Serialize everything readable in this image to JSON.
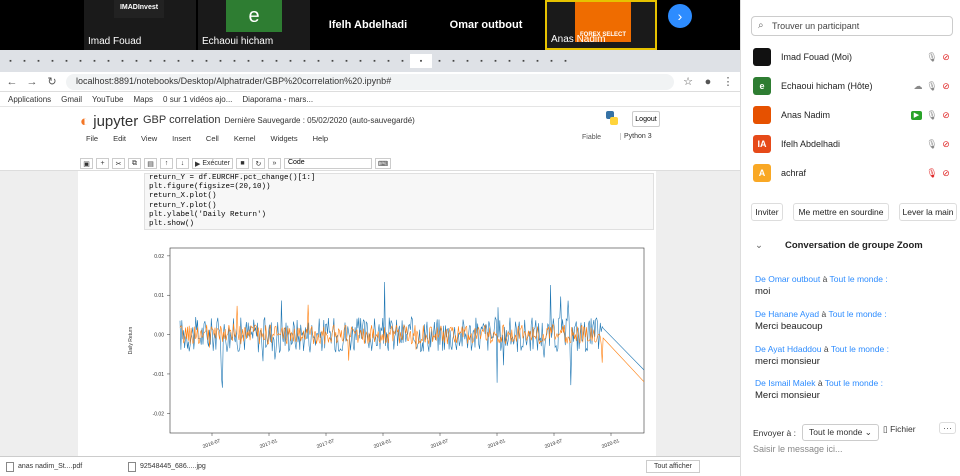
{
  "zoom_strip": {
    "tiles": [
      {
        "name": "Imad Fouad",
        "logo_text": "IMADInvest"
      },
      {
        "name": "Echaoui hicham",
        "avatar": "e"
      },
      {
        "name": "Ifelh Abdelhadi"
      },
      {
        "name": "Omar outbout"
      },
      {
        "name": "Anas Nadim",
        "logo_text": "FOREX SELECT"
      }
    ]
  },
  "browser": {
    "url": "localhost:8891/notebooks/Desktop/Alphatrader/GBP%20correlation%20.ipynb#",
    "bookmarks": [
      "Applications",
      "Gmail",
      "YouTube",
      "Maps",
      "0 sur 1 vidéos ajo...",
      "Diaporama - mars..."
    ]
  },
  "jupyter": {
    "logo": "jupyter",
    "notebook_title": "GBP correlation",
    "save_status": "Dernière Sauvegarde : 05/02/2020  (auto-sauvegardé)",
    "logout_label": "Logout",
    "menu": [
      "File",
      "Edit",
      "View",
      "Insert",
      "Cell",
      "Kernel",
      "Widgets",
      "Help"
    ],
    "trusted": "Fiable",
    "kernel": "Python 3",
    "run_label": "Exécuter",
    "cell_type": "Code",
    "code_lines": [
      "return_Y = df.EURCHF.pct_change()[1:]",
      "plt.figure(figsize=(20,10))",
      "return_X.plot()",
      "return_Y.plot()",
      "plt.ylabel('Daily Return')",
      "plt.show()"
    ]
  },
  "chart_data": {
    "type": "line",
    "ylabel": "Daily Return",
    "yticks": [
      0.02,
      0.01,
      0.0,
      -0.01,
      -0.02
    ],
    "ylim": [
      -0.025,
      0.022
    ],
    "xticks": [
      "2016-07",
      "2017-01",
      "2017-07",
      "2018-01",
      "2018-07",
      "2019-01",
      "2019-07",
      "2020-01"
    ],
    "series": [
      {
        "color": "#1f77b4",
        "amplitude": 0.0045
      },
      {
        "color": "#ff7f0e",
        "amplitude": 0.0025
      }
    ]
  },
  "downloads": {
    "items": [
      "anas nadim_St....pdf",
      "92548445_686.....jpg"
    ],
    "show_all": "Tout afficher"
  },
  "zoom_panel": {
    "search_placeholder": "Trouver un participant",
    "participants": [
      {
        "name": "Imad Fouad (Moi)",
        "avatar": "",
        "color": "#111111"
      },
      {
        "name": "Echaoui hicham (Hôte)",
        "avatar": "e",
        "color": "#2e7d32"
      },
      {
        "name": "Anas Nadim",
        "avatar": "",
        "color": "#e65100"
      },
      {
        "name": "Ifelh Abdelhadi",
        "avatar": "IA",
        "color": "#e64a19"
      },
      {
        "name": "achraf",
        "avatar": "A",
        "color": "#f9a825"
      }
    ],
    "buttons": [
      "Inviter",
      "Me mettre en sourdine",
      "Lever la main"
    ],
    "chat_title": "Conversation de groupe Zoom",
    "messages": [
      {
        "from": "Omar outbout",
        "to": "Tout le monde",
        "text": "moi"
      },
      {
        "from": "Hanane Ayad",
        "to": "Tout le monde",
        "text": "Merci beaucoup"
      },
      {
        "from": "Ayat Hdaddou",
        "to": "Tout le monde",
        "text": "merci monsieur"
      },
      {
        "from": "Ismail Malek",
        "to": "Tout le monde",
        "text": "Merci monsieur"
      }
    ],
    "send_to_label": "Envoyer à :",
    "send_to_value": "Tout le monde",
    "file_label": "Fichier",
    "input_placeholder": "Saisir le message ici..."
  }
}
